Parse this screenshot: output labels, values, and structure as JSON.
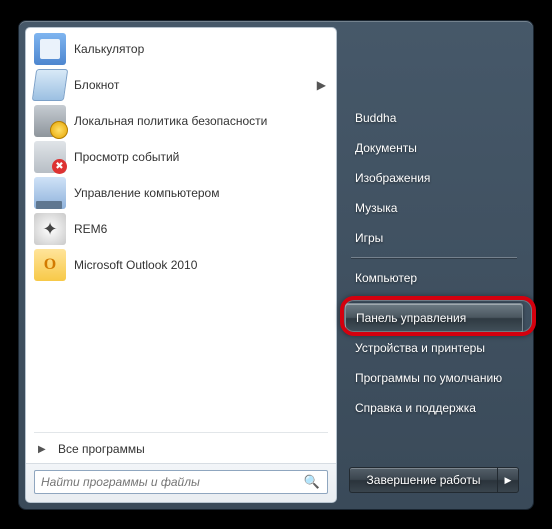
{
  "programs": [
    {
      "label": "Калькулятор",
      "icon": "calculator-icon",
      "has_submenu": false
    },
    {
      "label": "Блокнот",
      "icon": "notepad-icon",
      "has_submenu": true
    },
    {
      "label": "Локальная политика безопасности",
      "icon": "security-policy-icon",
      "has_submenu": false
    },
    {
      "label": "Просмотр событий",
      "icon": "event-viewer-icon",
      "has_submenu": false
    },
    {
      "label": "Управление компьютером",
      "icon": "computer-management-icon",
      "has_submenu": false
    },
    {
      "label": "REM6",
      "icon": "rem6-icon",
      "has_submenu": false
    },
    {
      "label": "Microsoft Outlook 2010",
      "icon": "outlook-icon",
      "has_submenu": false
    }
  ],
  "all_programs_label": "Все программы",
  "search": {
    "placeholder": "Найти программы и файлы"
  },
  "right_panel": {
    "user": "Buddha",
    "items_a": [
      "Документы",
      "Изображения",
      "Музыка",
      "Игры"
    ],
    "items_b": [
      "Компьютер"
    ],
    "items_c": [
      "Панель управления",
      "Устройства и принтеры",
      "Программы по умолчанию",
      "Справка и поддержка"
    ]
  },
  "shutdown": {
    "label": "Завершение работы"
  },
  "highlighted_item": "Панель управления"
}
